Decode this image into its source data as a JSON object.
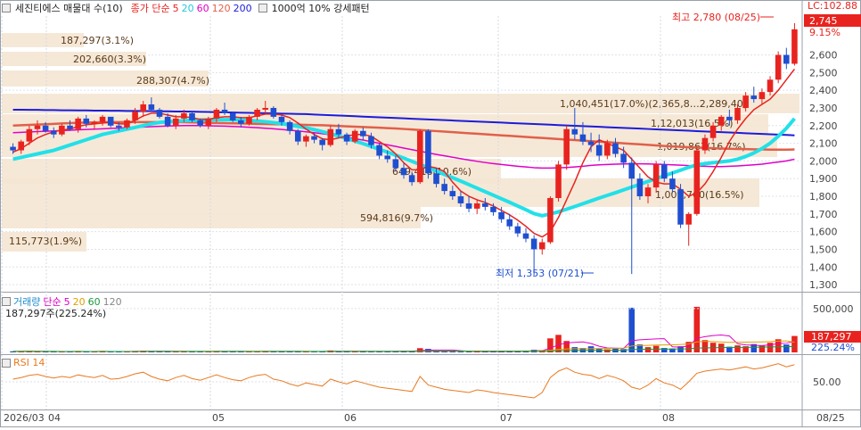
{
  "header": {
    "name_label": "세진티에스 매물대 수(10)",
    "price_label": "종가 단순",
    "ma_periods": [
      "5",
      "20",
      "60",
      "120",
      "200"
    ],
    "ma_colors": [
      "#e8231f",
      "#22c9d9",
      "#e000c8",
      "#e0604a",
      "#1c1cd8"
    ],
    "extra_label": "1000억 10% 강세패턴"
  },
  "lc_label": "LC:102.88",
  "price_axis": {
    "ticks": [
      "2,600",
      "2,500",
      "2,400",
      "2,300",
      "2,200",
      "2,100",
      "2,000",
      "1,900",
      "1,800",
      "1,700",
      "1,600",
      "1,500",
      "1,400",
      "1,300"
    ],
    "current_price": "2,745",
    "current_pct": "9.15%"
  },
  "volume_profile": [
    {
      "label": "187,297(3.1%)"
    },
    {
      "label": "202,660(3.3%)"
    },
    {
      "label": "288,307(4.7%)"
    },
    {
      "label": "1,040,451(17.0%)(2,365,8…2,289,40)"
    },
    {
      "label": "1,12,013(16.5%)"
    },
    {
      "label": "1,019,867(16.7%)"
    },
    {
      "label": "649,418(10.6%)"
    },
    {
      "label": "1,009,760(16.5%)"
    },
    {
      "label": "594,816(9.7%)"
    },
    {
      "label": "115,773(1.9%)"
    }
  ],
  "annotations": {
    "high": "최고 2,780 (08/25)",
    "low": "최저 1,353 (07/21)"
  },
  "volume_panel": {
    "title": "거래량",
    "ma_label": "단순",
    "ma_periods": [
      "5",
      "20",
      "60",
      "120"
    ],
    "ma_colors": [
      "#e000c8",
      "#e0a000",
      "#1a9a3a",
      "#888888"
    ],
    "info": "187,297주(225.24%)",
    "axis_tick": "500,000",
    "current_value": "187,297",
    "current_pct": "225.24%"
  },
  "rsi_panel": {
    "title": "RSI 14",
    "axis_tick": "50.00"
  },
  "date_axis": {
    "labels": [
      "2026/03",
      "04",
      "05",
      "06",
      "07",
      "08"
    ],
    "right_label": "08/25"
  },
  "chart_data": {
    "type": "candlestick",
    "y_range": [
      1270,
      2820
    ],
    "grid": true,
    "dates_start": "2026/03",
    "ohlc": [
      [
        2080,
        2100,
        2040,
        2060
      ],
      [
        2060,
        2120,
        2040,
        2110
      ],
      [
        2110,
        2200,
        2090,
        2180
      ],
      [
        2180,
        2230,
        2150,
        2200
      ],
      [
        2200,
        2220,
        2160,
        2170
      ],
      [
        2170,
        2190,
        2130,
        2150
      ],
      [
        2150,
        2210,
        2140,
        2200
      ],
      [
        2200,
        2230,
        2170,
        2180
      ],
      [
        2180,
        2250,
        2160,
        2240
      ],
      [
        2240,
        2260,
        2190,
        2210
      ],
      [
        2210,
        2230,
        2180,
        2220
      ],
      [
        2220,
        2260,
        2200,
        2250
      ],
      [
        2250,
        2240,
        2190,
        2200
      ],
      [
        2200,
        2220,
        2170,
        2190
      ],
      [
        2190,
        2240,
        2180,
        2230
      ],
      [
        2230,
        2300,
        2210,
        2280
      ],
      [
        2280,
        2340,
        2250,
        2320
      ],
      [
        2320,
        2360,
        2280,
        2290
      ],
      [
        2290,
        2300,
        2240,
        2250
      ],
      [
        2250,
        2270,
        2190,
        2200
      ],
      [
        2200,
        2260,
        2180,
        2240
      ],
      [
        2240,
        2290,
        2220,
        2270
      ],
      [
        2270,
        2280,
        2220,
        2230
      ],
      [
        2230,
        2240,
        2190,
        2200
      ],
      [
        2200,
        2250,
        2180,
        2240
      ],
      [
        2240,
        2300,
        2220,
        2290
      ],
      [
        2290,
        2330,
        2260,
        2270
      ],
      [
        2270,
        2280,
        2220,
        2230
      ],
      [
        2230,
        2250,
        2190,
        2210
      ],
      [
        2210,
        2260,
        2200,
        2250
      ],
      [
        2250,
        2300,
        2230,
        2290
      ],
      [
        2290,
        2340,
        2270,
        2300
      ],
      [
        2300,
        2310,
        2240,
        2250
      ],
      [
        2250,
        2260,
        2200,
        2220
      ],
      [
        2220,
        2230,
        2150,
        2170
      ],
      [
        2170,
        2180,
        2090,
        2110
      ],
      [
        2110,
        2150,
        2080,
        2140
      ],
      [
        2140,
        2160,
        2100,
        2120
      ],
      [
        2120,
        2130,
        2060,
        2090
      ],
      [
        2090,
        2200,
        2080,
        2180
      ],
      [
        2180,
        2210,
        2130,
        2150
      ],
      [
        2150,
        2160,
        2090,
        2110
      ],
      [
        2110,
        2180,
        2100,
        2170
      ],
      [
        2170,
        2190,
        2120,
        2140
      ],
      [
        2140,
        2160,
        2070,
        2090
      ],
      [
        2090,
        2100,
        2010,
        2030
      ],
      [
        2030,
        2060,
        1990,
        2010
      ],
      [
        2010,
        2030,
        1940,
        1960
      ],
      [
        1960,
        1990,
        1900,
        1920
      ],
      [
        1920,
        1940,
        1860,
        1880
      ],
      [
        1880,
        2180,
        1870,
        2170
      ],
      [
        2170,
        2180,
        1900,
        1930
      ],
      [
        1930,
        1960,
        1850,
        1870
      ],
      [
        1870,
        1900,
        1810,
        1830
      ],
      [
        1830,
        1860,
        1780,
        1800
      ],
      [
        1800,
        1830,
        1740,
        1760
      ],
      [
        1760,
        1800,
        1710,
        1730
      ],
      [
        1730,
        1780,
        1700,
        1760
      ],
      [
        1760,
        1790,
        1720,
        1740
      ],
      [
        1740,
        1760,
        1690,
        1710
      ],
      [
        1710,
        1740,
        1650,
        1670
      ],
      [
        1670,
        1700,
        1610,
        1630
      ],
      [
        1630,
        1650,
        1570,
        1590
      ],
      [
        1590,
        1620,
        1540,
        1560
      ],
      [
        1560,
        1580,
        1353,
        1500
      ],
      [
        1500,
        1560,
        1470,
        1540
      ],
      [
        1540,
        1800,
        1530,
        1790
      ],
      [
        1790,
        2000,
        1770,
        1980
      ],
      [
        1980,
        2200,
        1950,
        2180
      ],
      [
        2180,
        2300,
        2120,
        2150
      ],
      [
        2150,
        2220,
        2090,
        2110
      ],
      [
        2110,
        2160,
        2050,
        2090
      ],
      [
        2090,
        2150,
        2000,
        2030
      ],
      [
        2030,
        2120,
        2010,
        2100
      ],
      [
        2100,
        2130,
        2020,
        2040
      ],
      [
        2040,
        2080,
        1960,
        1990
      ],
      [
        1990,
        2020,
        1360,
        1900
      ],
      [
        1900,
        1930,
        1780,
        1800
      ],
      [
        1800,
        1870,
        1760,
        1850
      ],
      [
        1850,
        2000,
        1820,
        1980
      ],
      [
        1980,
        2000,
        1880,
        1900
      ],
      [
        1900,
        1940,
        1820,
        1840
      ],
      [
        1840,
        1870,
        1620,
        1640
      ],
      [
        1640,
        1710,
        1520,
        1700
      ],
      [
        1700,
        2080,
        1690,
        2060
      ],
      [
        2060,
        2150,
        2040,
        2130
      ],
      [
        2130,
        2220,
        2110,
        2200
      ],
      [
        2200,
        2260,
        2170,
        2250
      ],
      [
        2250,
        2290,
        2200,
        2230
      ],
      [
        2230,
        2320,
        2210,
        2300
      ],
      [
        2300,
        2390,
        2280,
        2370
      ],
      [
        2370,
        2420,
        2330,
        2350
      ],
      [
        2350,
        2410,
        2320,
        2390
      ],
      [
        2390,
        2480,
        2370,
        2460
      ],
      [
        2460,
        2620,
        2440,
        2600
      ],
      [
        2600,
        2640,
        2520,
        2550
      ],
      [
        2550,
        2780,
        2540,
        2745
      ]
    ],
    "volume": [
      12000,
      10000,
      15000,
      9000,
      11000,
      8000,
      10000,
      9000,
      14000,
      10000,
      9000,
      13000,
      8000,
      9000,
      10000,
      16000,
      18000,
      12000,
      10000,
      9000,
      10000,
      14000,
      9000,
      8000,
      11000,
      15000,
      12000,
      9000,
      8000,
      10000,
      13000,
      16000,
      10000,
      9000,
      11000,
      14000,
      9000,
      8000,
      10000,
      22000,
      12000,
      9000,
      11000,
      10000,
      13000,
      15000,
      11000,
      14000,
      16000,
      12000,
      48000,
      40000,
      18000,
      14000,
      12000,
      11000,
      9000,
      10000,
      9000,
      11000,
      12000,
      14000,
      16000,
      15000,
      30000,
      24000,
      160000,
      200000,
      130000,
      60000,
      50000,
      70000,
      40000,
      35000,
      45000,
      38000,
      510000,
      90000,
      60000,
      75000,
      50000,
      45000,
      70000,
      120000,
      520000,
      140000,
      110000,
      100000,
      65000,
      80000,
      70000,
      95000,
      80000,
      110000,
      150000,
      90000,
      187297
    ],
    "ma5": [
      2050,
      2070,
      2100,
      2130,
      2150,
      2165,
      2175,
      2180,
      2195,
      2205,
      2210,
      2215,
      2218,
      2210,
      2210,
      2230,
      2255,
      2270,
      2270,
      2260,
      2250,
      2250,
      2245,
      2235,
      2235,
      2245,
      2250,
      2250,
      2245,
      2245,
      2255,
      2265,
      2265,
      2260,
      2245,
      2215,
      2180,
      2150,
      2125,
      2120,
      2130,
      2140,
      2150,
      2150,
      2140,
      2110,
      2080,
      2040,
      1990,
      1950,
      1950,
      1970,
      1960,
      1940,
      1880,
      1830,
      1800,
      1780,
      1765,
      1745,
      1720,
      1695,
      1665,
      1630,
      1590,
      1570,
      1600,
      1680,
      1780,
      1880,
      1990,
      2080,
      2120,
      2100,
      2080,
      2060,
      2010,
      1960,
      1910,
      1880,
      1870,
      1870,
      1840,
      1800,
      1820,
      1870,
      1940,
      2020,
      2110,
      2180,
      2240,
      2290,
      2320,
      2350,
      2400,
      2460,
      2520
    ],
    "ma20": [
      2010,
      2020,
      2030,
      2040,
      2050,
      2060,
      2075,
      2090,
      2105,
      2120,
      2135,
      2150,
      2160,
      2170,
      2180,
      2190,
      2200,
      2210,
      2218,
      2222,
      2225,
      2228,
      2230,
      2232,
      2233,
      2234,
      2234,
      2233,
      2231,
      2229,
      2226,
      2222,
      2217,
      2211,
      2204,
      2196,
      2187,
      2177,
      2166,
      2154,
      2141,
      2127,
      2113,
      2098,
      2082,
      2066,
      2050,
      2033,
      2016,
      1998,
      1980,
      1962,
      1943,
      1924,
      1905,
      1886,
      1866,
      1846,
      1826,
      1806,
      1786,
      1766,
      1745,
      1724,
      1702,
      1690,
      1700,
      1712,
      1727,
      1742,
      1758,
      1774,
      1790,
      1805,
      1820,
      1836,
      1852,
      1868,
      1884,
      1900,
      1916,
      1932,
      1948,
      1964,
      1978,
      1985,
      1990,
      1995,
      2000,
      2010,
      2025,
      2045,
      2070,
      2100,
      2140,
      2185,
      2240
    ],
    "ma60": [
      2160,
      2162,
      2164,
      2166,
      2168,
      2170,
      2172,
      2174,
      2176,
      2178,
      2180,
      2182,
      2184,
      2186,
      2188,
      2190,
      2192,
      2194,
      2196,
      2198,
      2199,
      2200,
      2200,
      2200,
      2199,
      2198,
      2197,
      2195,
      2193,
      2191,
      2188,
      2185,
      2182,
      2178,
      2174,
      2170,
      2165,
      2160,
      2154,
      2148,
      2141,
      2134,
      2126,
      2118,
      2109,
      2100,
      2091,
      2082,
      2073,
      2064,
      2055,
      2046,
      2037,
      2029,
      2021,
      2013,
      2005,
      1998,
      1991,
      1985,
      1980,
      1975,
      1970,
      1966,
      1962,
      1960,
      1960,
      1961,
      1963,
      1966,
      1970,
      1975,
      1978,
      1980,
      1982,
      1983,
      1984,
      1984,
      1983,
      1982,
      1980,
      1978,
      1976,
      1974,
      1972,
      1970,
      1968,
      1968,
      1970,
      1972,
      1975,
      1978,
      1982,
      1988,
      1994,
      2000,
      2010
    ],
    "ma120": [
      2200,
      2202,
      2204,
      2206,
      2208,
      2210,
      2212,
      2214,
      2216,
      2217,
      2218,
      2219,
      2220,
      2220,
      2220,
      2220,
      2220,
      2220,
      2220,
      2220,
      2220,
      2219,
      2218,
      2217,
      2216,
      2215,
      2214,
      2213,
      2212,
      2211,
      2210,
      2209,
      2208,
      2207,
      2206,
      2205,
      2204,
      2203,
      2202,
      2200,
      2198,
      2196,
      2194,
      2192,
      2190,
      2188,
      2186,
      2184,
      2181,
      2178,
      2175,
      2172,
      2169,
      2166,
      2163,
      2160,
      2157,
      2154,
      2151,
      2148,
      2145,
      2142,
      2139,
      2136,
      2133,
      2130,
      2127,
      2124,
      2121,
      2118,
      2115,
      2112,
      2109,
      2106,
      2103,
      2100,
      2097,
      2094,
      2091,
      2088,
      2085,
      2082,
      2080,
      2078,
      2076,
      2074,
      2072,
      2070,
      2069,
      2068,
      2067,
      2066,
      2065,
      2064,
      2064,
      2064,
      2065
    ],
    "ma200": [
      2290,
      2290,
      2289,
      2289,
      2288,
      2288,
      2287,
      2287,
      2286,
      2286,
      2285,
      2285,
      2284,
      2284,
      2283,
      2283,
      2282,
      2282,
      2281,
      2281,
      2280,
      2280,
      2279,
      2278,
      2277,
      2276,
      2275,
      2274,
      2273,
      2272,
      2271,
      2270,
      2269,
      2268,
      2267,
      2266,
      2265,
      2263,
      2261,
      2259,
      2257,
      2255,
      2253,
      2251,
      2249,
      2247,
      2245,
      2243,
      2241,
      2239,
      2237,
      2235,
      2233,
      2231,
      2229,
      2227,
      2225,
      2223,
      2221,
      2219,
      2217,
      2215,
      2213,
      2211,
      2209,
      2207,
      2205,
      2203,
      2201,
      2199,
      2197,
      2195,
      2193,
      2191,
      2189,
      2187,
      2185,
      2183,
      2181,
      2179,
      2177,
      2175,
      2173,
      2171,
      2169,
      2167,
      2165,
      2163,
      2161,
      2159,
      2157,
      2155,
      2153,
      2151,
      2149,
      2147,
      2145
    ],
    "rsi": [
      55,
      58,
      62,
      64,
      60,
      57,
      60,
      58,
      63,
      60,
      58,
      62,
      55,
      56,
      60,
      65,
      68,
      60,
      55,
      52,
      58,
      62,
      56,
      53,
      58,
      63,
      58,
      54,
      52,
      58,
      62,
      64,
      55,
      52,
      46,
      42,
      48,
      45,
      42,
      55,
      50,
      46,
      52,
      48,
      44,
      40,
      38,
      36,
      34,
      32,
      60,
      44,
      40,
      36,
      34,
      32,
      30,
      35,
      33,
      30,
      28,
      26,
      24,
      22,
      20,
      30,
      58,
      70,
      76,
      68,
      64,
      62,
      56,
      62,
      58,
      52,
      40,
      36,
      44,
      56,
      48,
      44,
      36,
      50,
      66,
      70,
      72,
      74,
      72,
      75,
      78,
      74,
      76,
      80,
      84,
      78,
      82
    ]
  }
}
